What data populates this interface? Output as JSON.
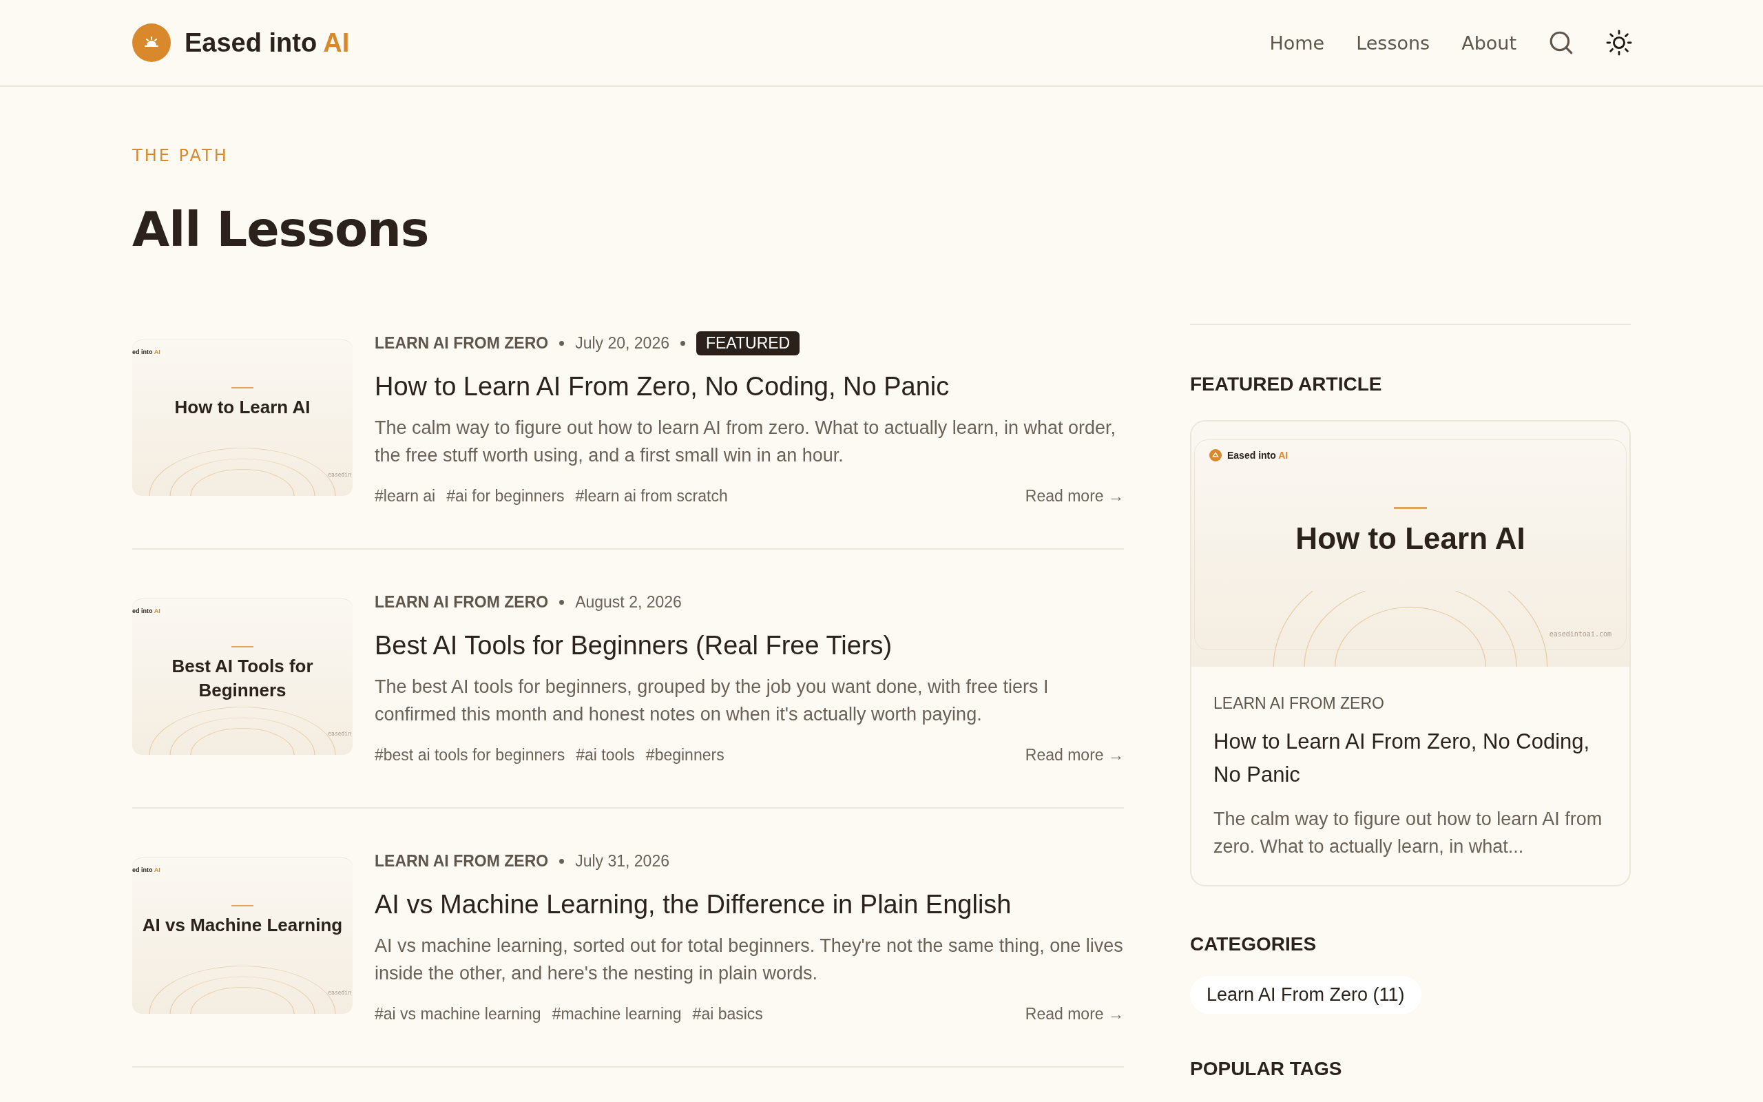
{
  "header": {
    "brand": {
      "text": "Eased into",
      "accent": "AI"
    },
    "nav": [
      {
        "label": "Home"
      },
      {
        "label": "Lessons"
      },
      {
        "label": "About"
      }
    ]
  },
  "page": {
    "eyebrow": "THE PATH",
    "title": "All Lessons"
  },
  "lessons": [
    {
      "cover": {
        "brand": "ed into",
        "accent": "AI",
        "title": "How to Learn AI",
        "domain": "easedin"
      },
      "category": "LEARN AI FROM ZERO",
      "date": "July 20, 2026",
      "badge": "FEATURED",
      "title": "How to Learn AI From Zero, No Coding, No Panic",
      "excerpt": "The calm way to figure out how to learn AI from zero. What to actually learn, in what order, the free stuff worth using, and a first small win in an hour.",
      "tags": [
        "#learn ai",
        "#ai for beginners",
        "#learn ai from scratch"
      ],
      "read_more": "Read more →"
    },
    {
      "cover": {
        "brand": "ed into",
        "accent": "AI",
        "title": "Best AI Tools for Beginners",
        "domain": "easedin"
      },
      "category": "LEARN AI FROM ZERO",
      "date": "August 2, 2026",
      "title": "Best AI Tools for Beginners (Real Free Tiers)",
      "excerpt": "The best AI tools for beginners, grouped by the job you want done, with free tiers I confirmed this month and honest notes on when it's actually worth paying.",
      "tags": [
        "#best ai tools for beginners",
        "#ai tools",
        "#beginners"
      ],
      "read_more": "Read more →"
    },
    {
      "cover": {
        "brand": "ed into",
        "accent": "AI",
        "title": "AI vs Machine Learning",
        "domain": "easedin"
      },
      "category": "LEARN AI FROM ZERO",
      "date": "July 31, 2026",
      "title": "AI vs Machine Learning, the Difference in Plain English",
      "excerpt": "AI vs machine learning, sorted out for total beginners. They're not the same thing, one lives inside the other, and here's the nesting in plain words.",
      "tags": [
        "#ai vs machine learning",
        "#machine learning",
        "#ai basics"
      ],
      "read_more": "Read more →"
    }
  ],
  "sidebar": {
    "featured": {
      "heading": "FEATURED ARTICLE",
      "cover": {
        "brand": "Eased into",
        "accent": "AI",
        "title": "How to Learn AI",
        "domain": "easedintoai.com"
      },
      "category": "LEARN AI FROM ZERO",
      "title": "How to Learn AI From Zero, No Coding, No Panic",
      "excerpt": "The calm way to figure out how to learn AI from zero. What to actually learn, in what..."
    },
    "categories": {
      "heading": "CATEGORIES",
      "items": [
        {
          "label": "Learn AI From Zero (11)"
        }
      ]
    },
    "popular_tags": {
      "heading": "POPULAR TAGS"
    }
  }
}
